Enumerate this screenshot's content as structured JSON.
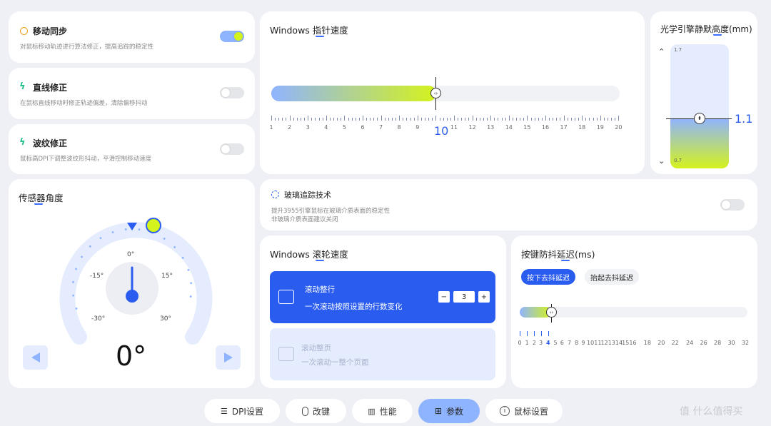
{
  "toggles": {
    "motion_sync": {
      "title": "移动同步",
      "desc": "对鼠标移动轨迹进行算法修正，提高追踪的稳定性",
      "on": true
    },
    "line_correction": {
      "title": "直线修正",
      "desc": "在鼠标直线移动时修正轨迹偏差，清除偏移抖动",
      "on": false
    },
    "ripple_correction": {
      "title": "波纹修正",
      "desc": "鼠标高DPI下调整波纹形抖动，平滑控制移动速度",
      "on": false
    }
  },
  "pointer_speed": {
    "title": "Windows 指针速度",
    "value": "10",
    "scale": [
      "1",
      "2",
      "3",
      "4",
      "5",
      "6",
      "7",
      "8",
      "9",
      "10",
      "11",
      "12",
      "13",
      "14",
      "15",
      "16",
      "17",
      "18",
      "19",
      "20"
    ]
  },
  "lod": {
    "title": "光学引擎静默高度(mm)",
    "max": "1.7",
    "min": "0.7",
    "value": "1.1",
    "up_icon": "chevron-up-icon",
    "down_icon": "chevron-down-icon"
  },
  "sensor_angle": {
    "title": "传感器角度",
    "value": "0°",
    "ticks": {
      "t0": "0°",
      "tm15": "-15°",
      "t15": "15°",
      "tm30": "-30°",
      "t30": "30°"
    }
  },
  "glass_tracking": {
    "title": "玻璃追踪技术",
    "desc1": "提升3955引擎鼠标在玻璃介质表面的稳定性",
    "desc2": "非玻璃介质表面建议关闭",
    "on": false
  },
  "scroll_speed": {
    "title": "Windows 滚轮速度",
    "line_title": "滚动整行",
    "line_desc": "一次滚动按照设置的行数变化",
    "line_value": "3",
    "minus": "−",
    "plus": "+",
    "page_title": "滚动整页",
    "page_desc": "一次滚动一整个页面"
  },
  "debounce": {
    "title": "按键防抖延迟(ms)",
    "tab_press": "按下去抖延迟",
    "tab_release": "抬起去抖延迟",
    "value": 4,
    "scale": [
      "0",
      "1",
      "2",
      "3",
      "4",
      "5",
      "6",
      "7",
      "8",
      "9",
      "10",
      "11",
      "12",
      "13",
      "14",
      "15",
      "16",
      "18",
      "20",
      "22",
      "24",
      "26",
      "28",
      "30",
      "32"
    ]
  },
  "bottom_tabs": [
    {
      "label": "DPI设置",
      "icon": "dpi-icon"
    },
    {
      "label": "改键",
      "icon": "mouse-icon"
    },
    {
      "label": "性能",
      "icon": "performance-chart-icon"
    },
    {
      "label": "参数",
      "icon": "grid-icon",
      "active": true
    },
    {
      "label": "鼠标设置",
      "icon": "info-icon"
    }
  ],
  "watermark": "值 什么值得买",
  "colors": {
    "accent": "#2a5cf0",
    "lime": "#d4f21c",
    "light_blue": "#8fb4ff"
  }
}
